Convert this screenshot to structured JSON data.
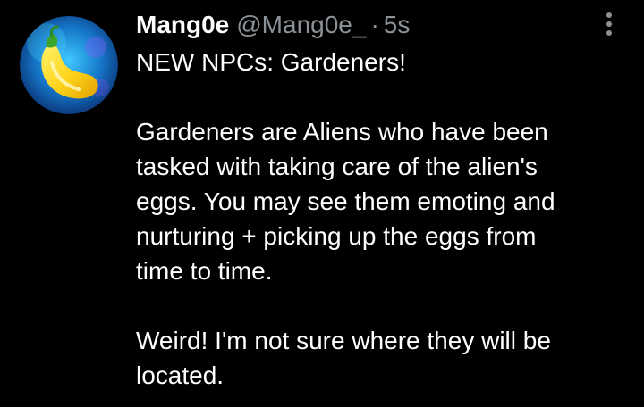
{
  "tweet": {
    "author": {
      "display_name": "Mang0e",
      "handle": "@Mang0e_",
      "avatar_icon": "eggplant-icon"
    },
    "separator": "·",
    "timestamp": "5s",
    "more_icon": "more-vertical-icon",
    "text_lines": [
      "NEW NPCs: Gardeners!",
      "",
      "Gardeners are Aliens who have been",
      "tasked with taking care of the alien's",
      "eggs. You may see them emoting and",
      "nurturing + picking up the eggs from",
      "time to time.",
      "",
      "Weird! I'm not sure where they will be",
      "located."
    ]
  },
  "colors": {
    "background": "#000000",
    "primary_text": "#ffffff",
    "secondary_text": "#8b9196"
  }
}
